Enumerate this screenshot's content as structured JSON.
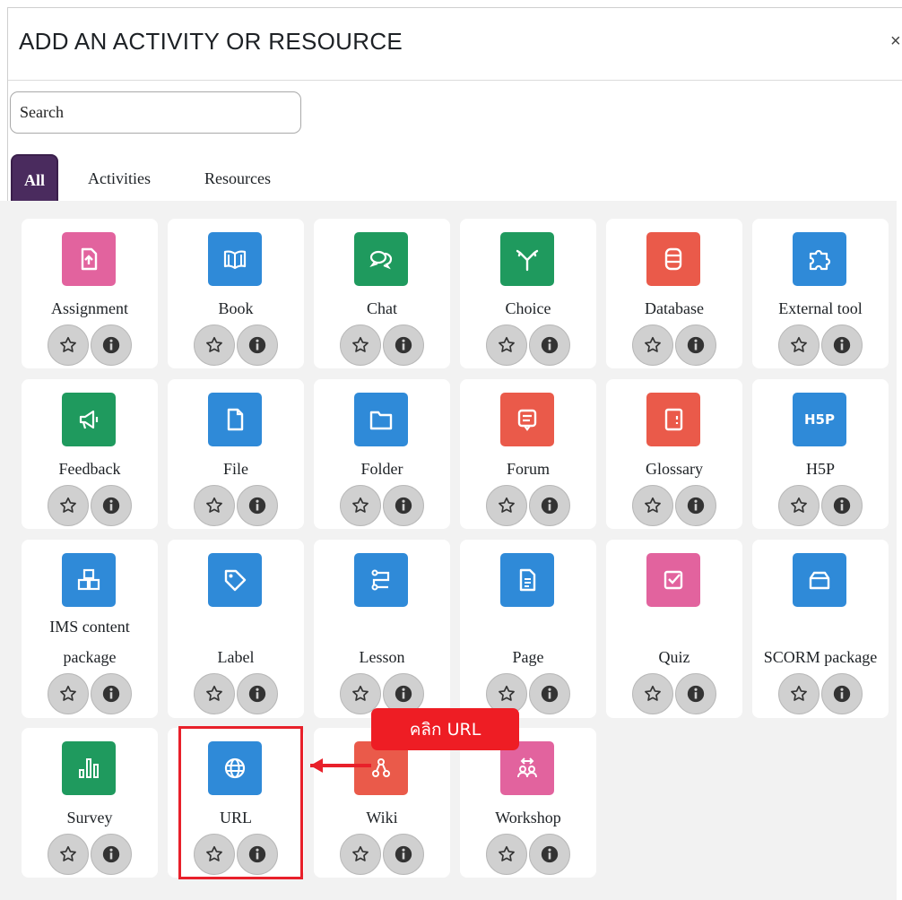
{
  "dialog": {
    "title": "ADD AN ACTIVITY OR RESOURCE",
    "close_label": "×"
  },
  "search": {
    "placeholder": "Search"
  },
  "tabs": [
    {
      "label": "All",
      "active": true
    },
    {
      "label": "Activities",
      "active": false
    },
    {
      "label": "Resources",
      "active": false
    }
  ],
  "modules": [
    {
      "name": "Assignment",
      "color": "#e2639e",
      "icon": "assignment-icon"
    },
    {
      "name": "Book",
      "color": "#2f8ad8",
      "icon": "book-icon"
    },
    {
      "name": "Chat",
      "color": "#1f9a5e",
      "icon": "chat-icon"
    },
    {
      "name": "Choice",
      "color": "#1f9a5e",
      "icon": "choice-icon"
    },
    {
      "name": "Database",
      "color": "#ea5a4a",
      "icon": "database-icon"
    },
    {
      "name": "External tool",
      "color": "#2f8ad8",
      "icon": "puzzle-icon"
    },
    {
      "name": "Feedback",
      "color": "#1f9a5e",
      "icon": "megaphone-icon"
    },
    {
      "name": "File",
      "color": "#2f8ad8",
      "icon": "file-icon"
    },
    {
      "name": "Folder",
      "color": "#2f8ad8",
      "icon": "folder-icon"
    },
    {
      "name": "Forum",
      "color": "#ea5a4a",
      "icon": "forum-icon"
    },
    {
      "name": "Glossary",
      "color": "#ea5a4a",
      "icon": "glossary-icon"
    },
    {
      "name": "H5P",
      "color": "#2f8ad8",
      "icon": "h5p-icon",
      "icon_text": "H5P"
    },
    {
      "name_line1": "IMS content",
      "name_line2": "package",
      "color": "#2f8ad8",
      "icon": "ims-package-icon"
    },
    {
      "name": "Label",
      "color": "#2f8ad8",
      "icon": "tag-icon"
    },
    {
      "name": "Lesson",
      "color": "#2f8ad8",
      "icon": "lesson-icon"
    },
    {
      "name": "Page",
      "color": "#2f8ad8",
      "icon": "page-icon"
    },
    {
      "name": "Quiz",
      "color": "#e2639e",
      "icon": "quiz-icon"
    },
    {
      "name": "SCORM package",
      "color": "#2f8ad8",
      "icon": "scorm-icon"
    },
    {
      "name": "Survey",
      "color": "#1f9a5e",
      "icon": "survey-chart-icon"
    },
    {
      "name": "URL",
      "color": "#2f8ad8",
      "icon": "globe-icon"
    },
    {
      "name": "Wiki",
      "color": "#ea5a4a",
      "icon": "wiki-icon"
    },
    {
      "name": "Workshop",
      "color": "#e2639e",
      "icon": "workshop-icon"
    }
  ],
  "annotation": {
    "callout_text": "คลิก URL",
    "highlight_color": "#e8202a"
  }
}
